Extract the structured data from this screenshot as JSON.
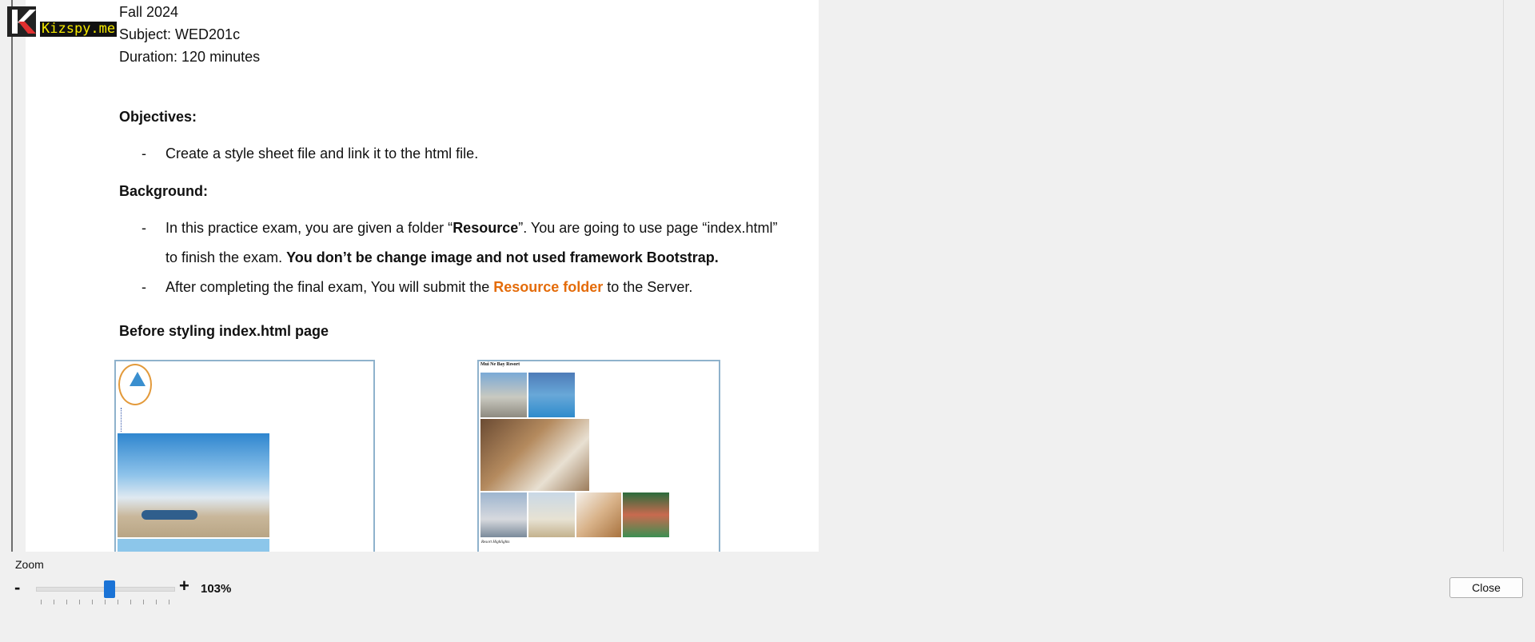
{
  "watermark": {
    "text": "Kizspy.me"
  },
  "document": {
    "header_lines": [
      "Fall 2024",
      "Subject: WED201c",
      "Duration: 120 minutes"
    ],
    "objectives": {
      "heading": "Objectives:",
      "items": [
        "Create a style sheet file and link it to the html file."
      ]
    },
    "background": {
      "heading": "Background:",
      "item1_a": "In this practice exam, you are given a folder “",
      "item1_b": "Resource",
      "item1_c": "”. You are going to use page “index.html”",
      "item1_d": "to finish the exam. ",
      "item1_e": "You don’t be change image and not used framework Bootstrap.",
      "item2_a": "After completing the final exam, You will submit the ",
      "item2_b": "Resource folder",
      "item2_c": " to the Server."
    },
    "bullet": "-",
    "before_heading": "Before styling index.html page",
    "figure2_title": "Mui Ne Bay Resort",
    "figure2_subtitle": "Resort Highlights"
  },
  "zoom": {
    "label": "Zoom",
    "minus": "-",
    "plus": "+",
    "value_text": "103%",
    "level_fraction": 0.53
  },
  "close_button": {
    "label": "Close"
  },
  "colors": {
    "accent_orange": "#e46c0a",
    "slider_blue": "#1a73d6",
    "figure_border": "#8fb2cc"
  }
}
